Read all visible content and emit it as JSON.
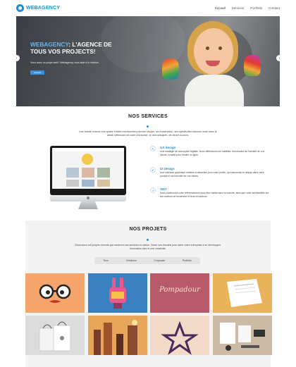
{
  "header": {
    "logo_text": "WEBAGENCY",
    "nav": [
      "Accueil",
      "Services",
      "Portfolio",
      "Contact"
    ]
  },
  "hero": {
    "title_accent": "WEBAGENCY",
    "title_rest": ": L'AGENCE DE TOUS VOS PROJECTS!",
    "subtitle": "Vous avez un projet web? Webagency vous aide à le réaliser.",
    "button_label": "Contact",
    "arrow_left": "‹",
    "arrow_right": "›"
  },
  "services": {
    "title": "NOS SERVICES",
    "lead": "Une bande nomme nos quatre entités coordonnées forment équipe, sa construction, ses spécificités chacune reste dans le détail, définissez de votre entreprise, ce des anticipée, de dévier à-cours.",
    "items": [
      {
        "icon": "pen-icon",
        "glyph": "✎",
        "title": "UX design",
        "desc": "Une stratégie de conception digitale. Nous définissons les habilités, les besoins de l'identité de vos clients, livrable pour étudier en ligne."
      },
      {
        "icon": "pencil-icon",
        "glyph": "✐",
        "title": "UI design",
        "desc": "Une interface graphique intuitive et attractive pour votre public, qui harmonise le design dans votre produit et son identité de vos clients."
      },
      {
        "icon": "chart-icon",
        "glyph": "↗",
        "title": "SEO",
        "desc": "Nous améliorons votre référencement pour être visible dans le marché, ainsi que votre accessibilité sur les moteurs de recherche et leurs évolutions."
      }
    ]
  },
  "projects": {
    "title": "NOS PROJETS",
    "lead": "Découvrez nos projets récents qui montrent nos services en action. Selon vos besoins pour aider votre entreprise à se développer, innovation clés et une créativité.",
    "filters": [
      "Tous",
      "Créations",
      "Corporate",
      "Portfolio"
    ],
    "tiles": [
      {
        "name": "project-glasses",
        "bg": "#f5a46b"
      },
      {
        "name": "project-rabbit",
        "bg": "#3a7fbf"
      },
      {
        "name": "project-pompadour",
        "bg": "#b85a6a"
      },
      {
        "name": "project-paper",
        "bg": "#e8b35a"
      },
      {
        "name": "project-bags",
        "bg": "#dcdcdc"
      },
      {
        "name": "project-city",
        "bg": "#d6843c"
      },
      {
        "name": "project-logo",
        "bg": "#f3d9c8"
      },
      {
        "name": "project-stationery",
        "bg": "#cdbba6"
      }
    ],
    "tile_text": "Pompadour"
  }
}
